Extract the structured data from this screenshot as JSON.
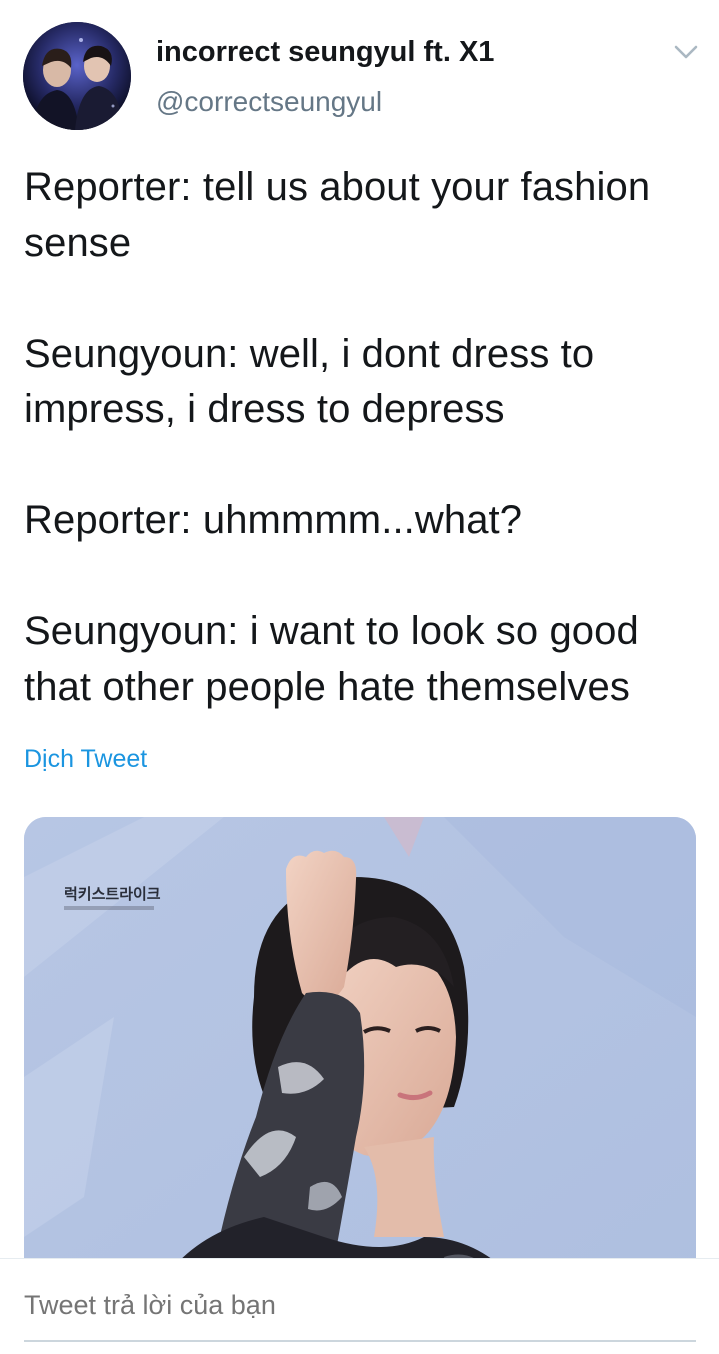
{
  "tweet": {
    "display_name": "incorrect seungyul ft. X1",
    "handle": "@correctseungyul",
    "text": "Reporter: tell us about your fashion sense\n\nSeungyoun: well, i dont dress to impress, i dress to depress\n\nReporter: uhmmmm...what?\n\nSeungyoun: i want to look so good that other people hate themselves",
    "translate_label": "Dịch Tweet",
    "media_watermark": "럭키스트라이크"
  },
  "reply": {
    "placeholder": "Tweet trả lời của bạn"
  },
  "icons": {
    "menu": "chevron-down-icon"
  },
  "colors": {
    "link": "#1b95e0",
    "secondary_text": "#657786",
    "primary_text": "#14171a"
  }
}
